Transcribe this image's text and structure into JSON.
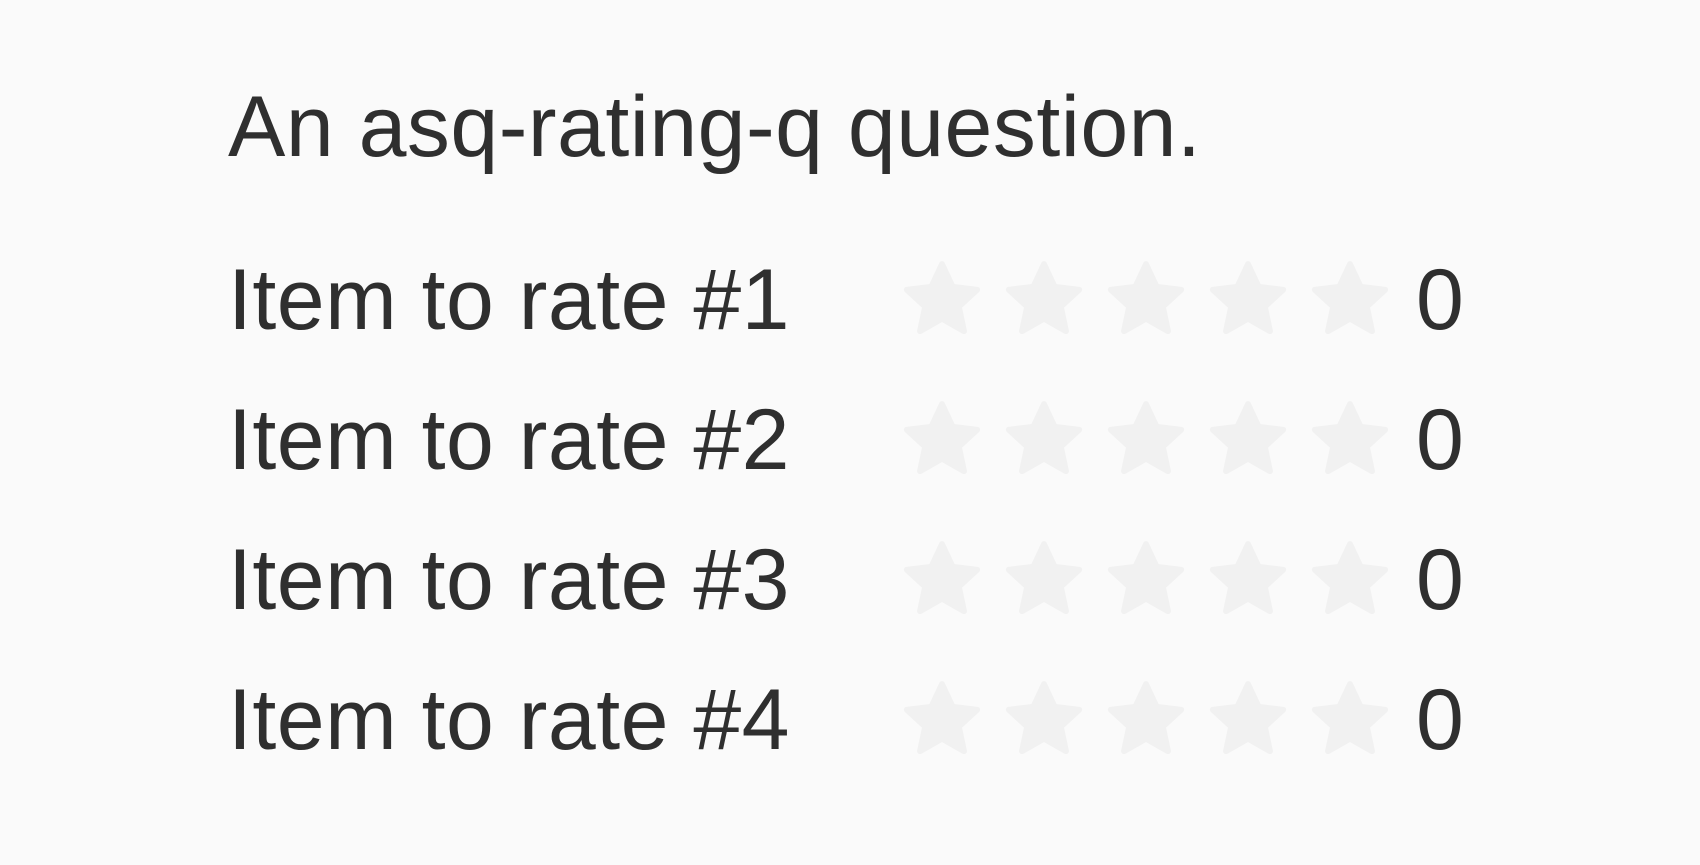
{
  "question": {
    "title": "An asq-rating-q question.",
    "max_stars": 5,
    "star_empty_color": "#f1f1f1",
    "items": [
      {
        "label": "Item to rate #1",
        "value": "0"
      },
      {
        "label": "Item to rate #2",
        "value": "0"
      },
      {
        "label": "Item to rate #3",
        "value": "0"
      },
      {
        "label": "Item to rate #4",
        "value": "0"
      }
    ]
  }
}
